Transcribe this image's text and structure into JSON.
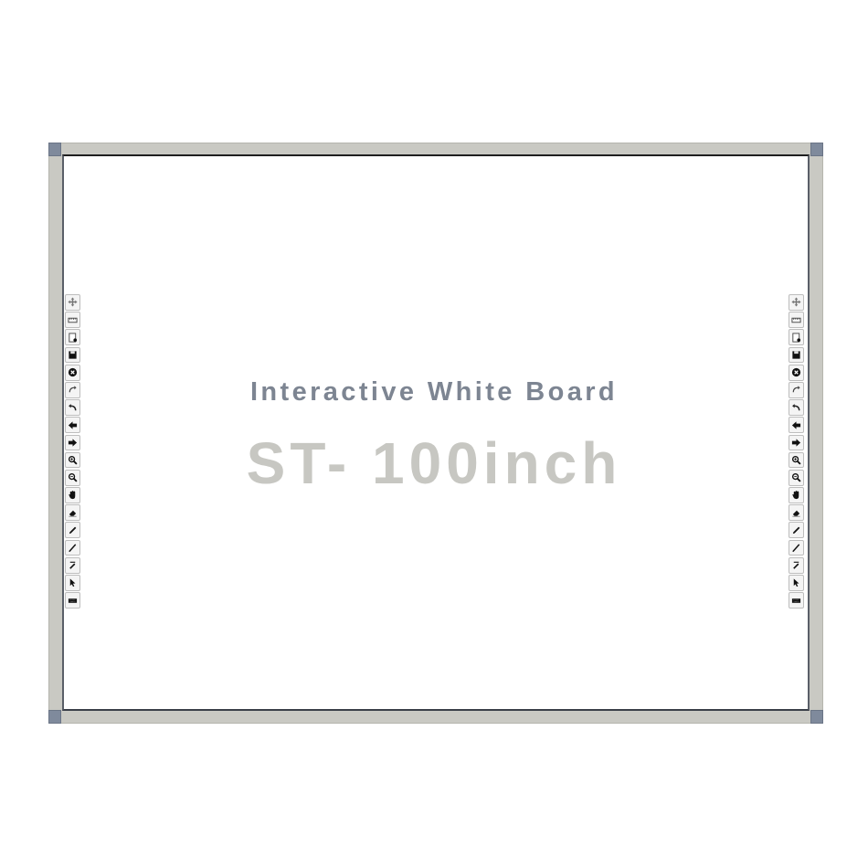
{
  "board": {
    "subtitle": "Interactive White Board",
    "model": "ST- 100inch"
  },
  "colors": {
    "frame": "#c9c9c3",
    "corner": "#7f8a9c",
    "subtitle": "#7d8592",
    "model": "#c7c7c2"
  },
  "toolbar": {
    "icons": [
      "move-icon",
      "ruler-icon",
      "new-page-icon",
      "save-icon",
      "close-icon",
      "redo-icon",
      "undo-icon",
      "previous-page-icon",
      "next-page-icon",
      "zoom-in-icon",
      "zoom-out-icon",
      "hand-icon",
      "eraser-icon",
      "pen-icon",
      "pencil-icon",
      "highlighter-icon",
      "pointer-icon",
      "keyboard-icon"
    ]
  }
}
